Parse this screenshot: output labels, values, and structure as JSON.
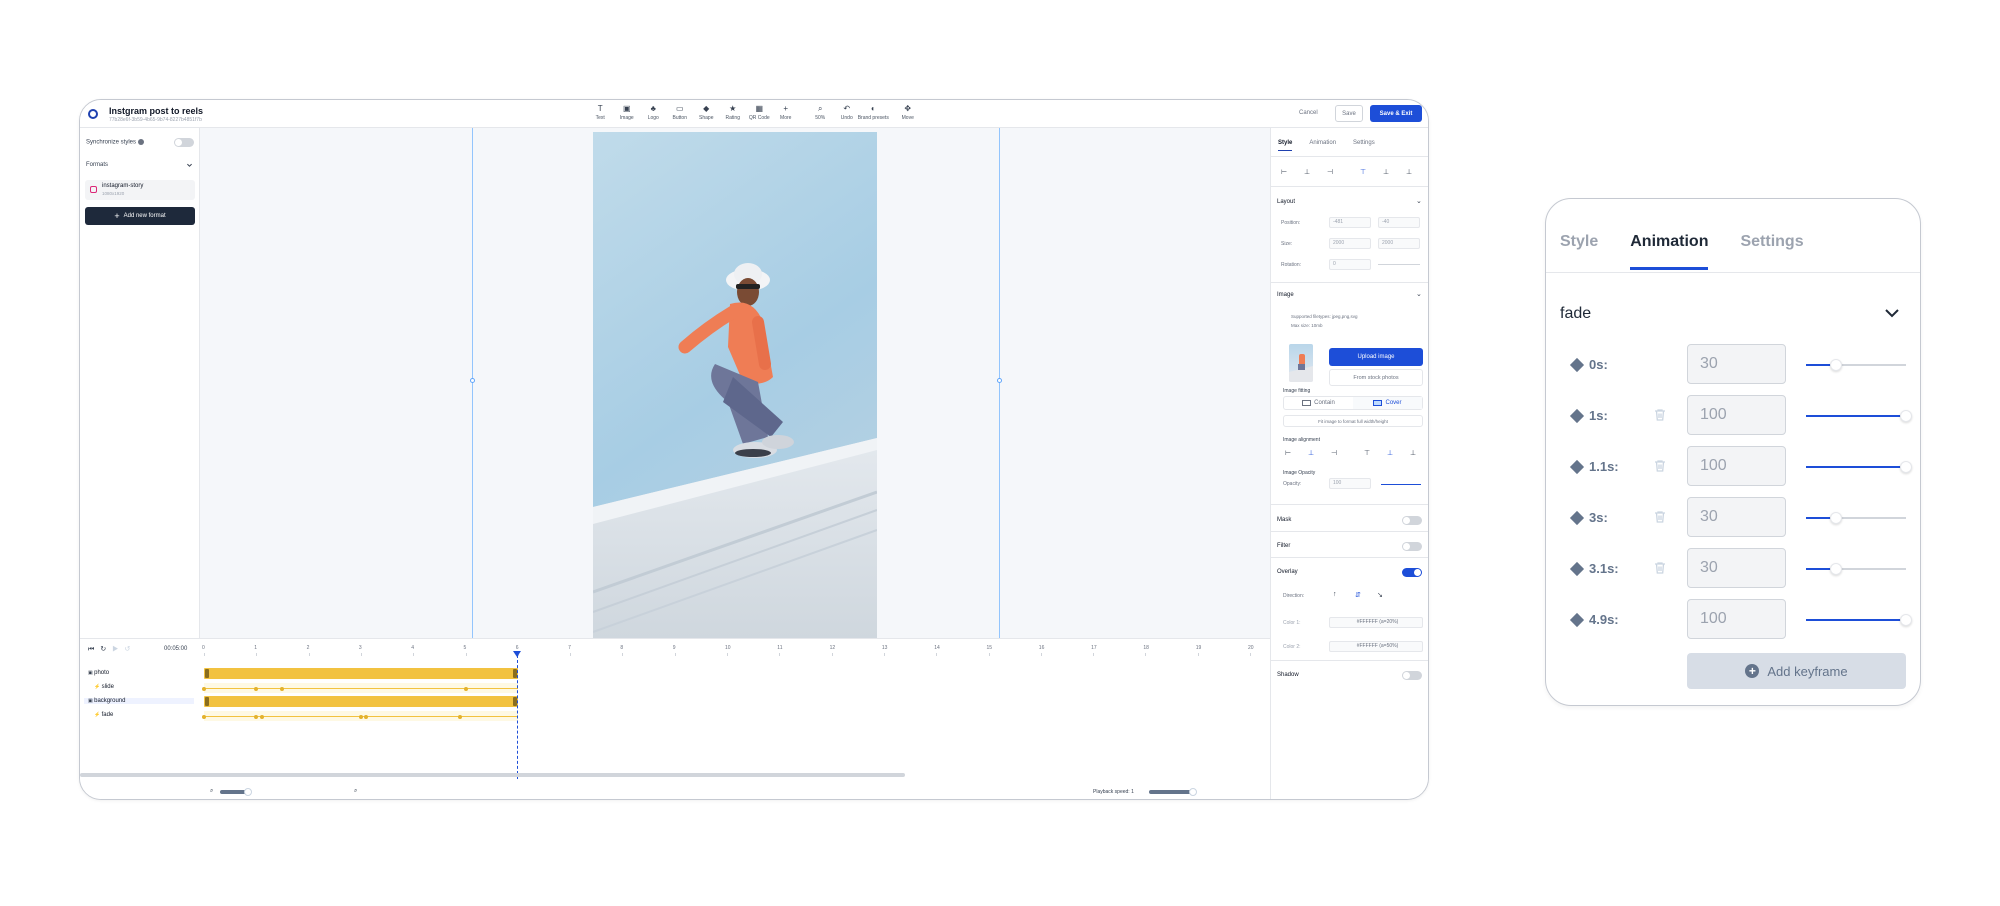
{
  "app": {
    "title": "Instgram post to reels",
    "subtitle": "77b28e6f-3b59-4b65-9b74-8227b4851f7b"
  },
  "toolbar": {
    "tools": [
      {
        "label": "Text",
        "icon": "text-icon"
      },
      {
        "label": "Image",
        "icon": "image-icon"
      },
      {
        "label": "Logo",
        "icon": "logo-icon"
      },
      {
        "label": "Button",
        "icon": "button-icon"
      },
      {
        "label": "Shape",
        "icon": "shape-icon"
      },
      {
        "label": "Rating",
        "icon": "star-icon"
      },
      {
        "label": "QR Code",
        "icon": "qr-code-icon"
      },
      {
        "label": "More",
        "icon": "plus-icon"
      }
    ],
    "tools2": [
      {
        "label": "50%",
        "icon": "zoom-icon"
      },
      {
        "label": "Undo",
        "icon": "undo-icon"
      },
      {
        "label": "Brand presets",
        "icon": "palette-icon"
      }
    ],
    "move_label": "Move",
    "cancel": "Cancel",
    "save": "Save",
    "save_exit": "Save & Exit"
  },
  "left_panel": {
    "sync_label": "Synchronize styles",
    "formats_label": "Formats",
    "format": {
      "name": "instagram-story",
      "size": "1080x1920"
    },
    "add_format": "Add new format"
  },
  "right_panel": {
    "tabs": [
      "Style",
      "Animation",
      "Settings"
    ],
    "layout": {
      "title": "Layout",
      "position_label": "Position:",
      "position": [
        "-481",
        "-40"
      ],
      "size_label": "Size:",
      "size": [
        "2000",
        "2000"
      ],
      "rotation_label": "Rotation:",
      "rotation": "0"
    },
    "image": {
      "title": "Image",
      "supported": "Supported filetypes: jpeg,png,svg",
      "max_size": "Max size: 10mb",
      "upload": "Upload image",
      "stock": "From stock photos",
      "fitting_label": "Image fitting",
      "contain": "Contain",
      "cover": "Cover",
      "fit_note": "Fit image to format full width/height",
      "alignment_label": "Image alignment",
      "opacity_label": "Image Opacity",
      "opacity_field_label": "Opacity:",
      "opacity": "100"
    },
    "mask": "Mask",
    "filter": "Filter",
    "overlay": "Overlay",
    "direction_label": "Direction:",
    "color1_label": "Color 1:",
    "color1": "#FFFFFF (a=20%)",
    "color2_label": "Color 2:",
    "color2": "#FFFFFF (a=50%)",
    "shadow": "Shadow"
  },
  "timeline": {
    "time": "00:05:00",
    "ticks": [
      "0",
      "1",
      "2",
      "3",
      "4",
      "5",
      "6",
      "7",
      "8",
      "9",
      "10",
      "11",
      "12",
      "13",
      "14",
      "15",
      "16",
      "17",
      "18",
      "19",
      "20"
    ],
    "tracks": [
      {
        "name": "photo",
        "type": "layer"
      },
      {
        "name": "slide",
        "type": "animation"
      },
      {
        "name": "background",
        "type": "layer"
      },
      {
        "name": "fade",
        "type": "animation"
      }
    ],
    "playback_label": "Playback speed: 1"
  },
  "animation_panel": {
    "tabs": [
      "Style",
      "Animation",
      "Settings"
    ],
    "active_tab": "Animation",
    "title": "fade",
    "keyframes": [
      {
        "time": "0s:",
        "value": "30",
        "level": 0.3,
        "deletable": false
      },
      {
        "time": "1s:",
        "value": "100",
        "level": 1.0,
        "deletable": true
      },
      {
        "time": "1.1s:",
        "value": "100",
        "level": 1.0,
        "deletable": true
      },
      {
        "time": "3s:",
        "value": "30",
        "level": 0.3,
        "deletable": true
      },
      {
        "time": "3.1s:",
        "value": "30",
        "level": 0.3,
        "deletable": true
      },
      {
        "time": "4.9s:",
        "value": "100",
        "level": 1.0,
        "deletable": false
      }
    ],
    "add_keyframe": "Add keyframe"
  },
  "colors": {
    "accent": "#1d4ed8",
    "bar": "#f2c240",
    "dark": "#1e293b"
  }
}
